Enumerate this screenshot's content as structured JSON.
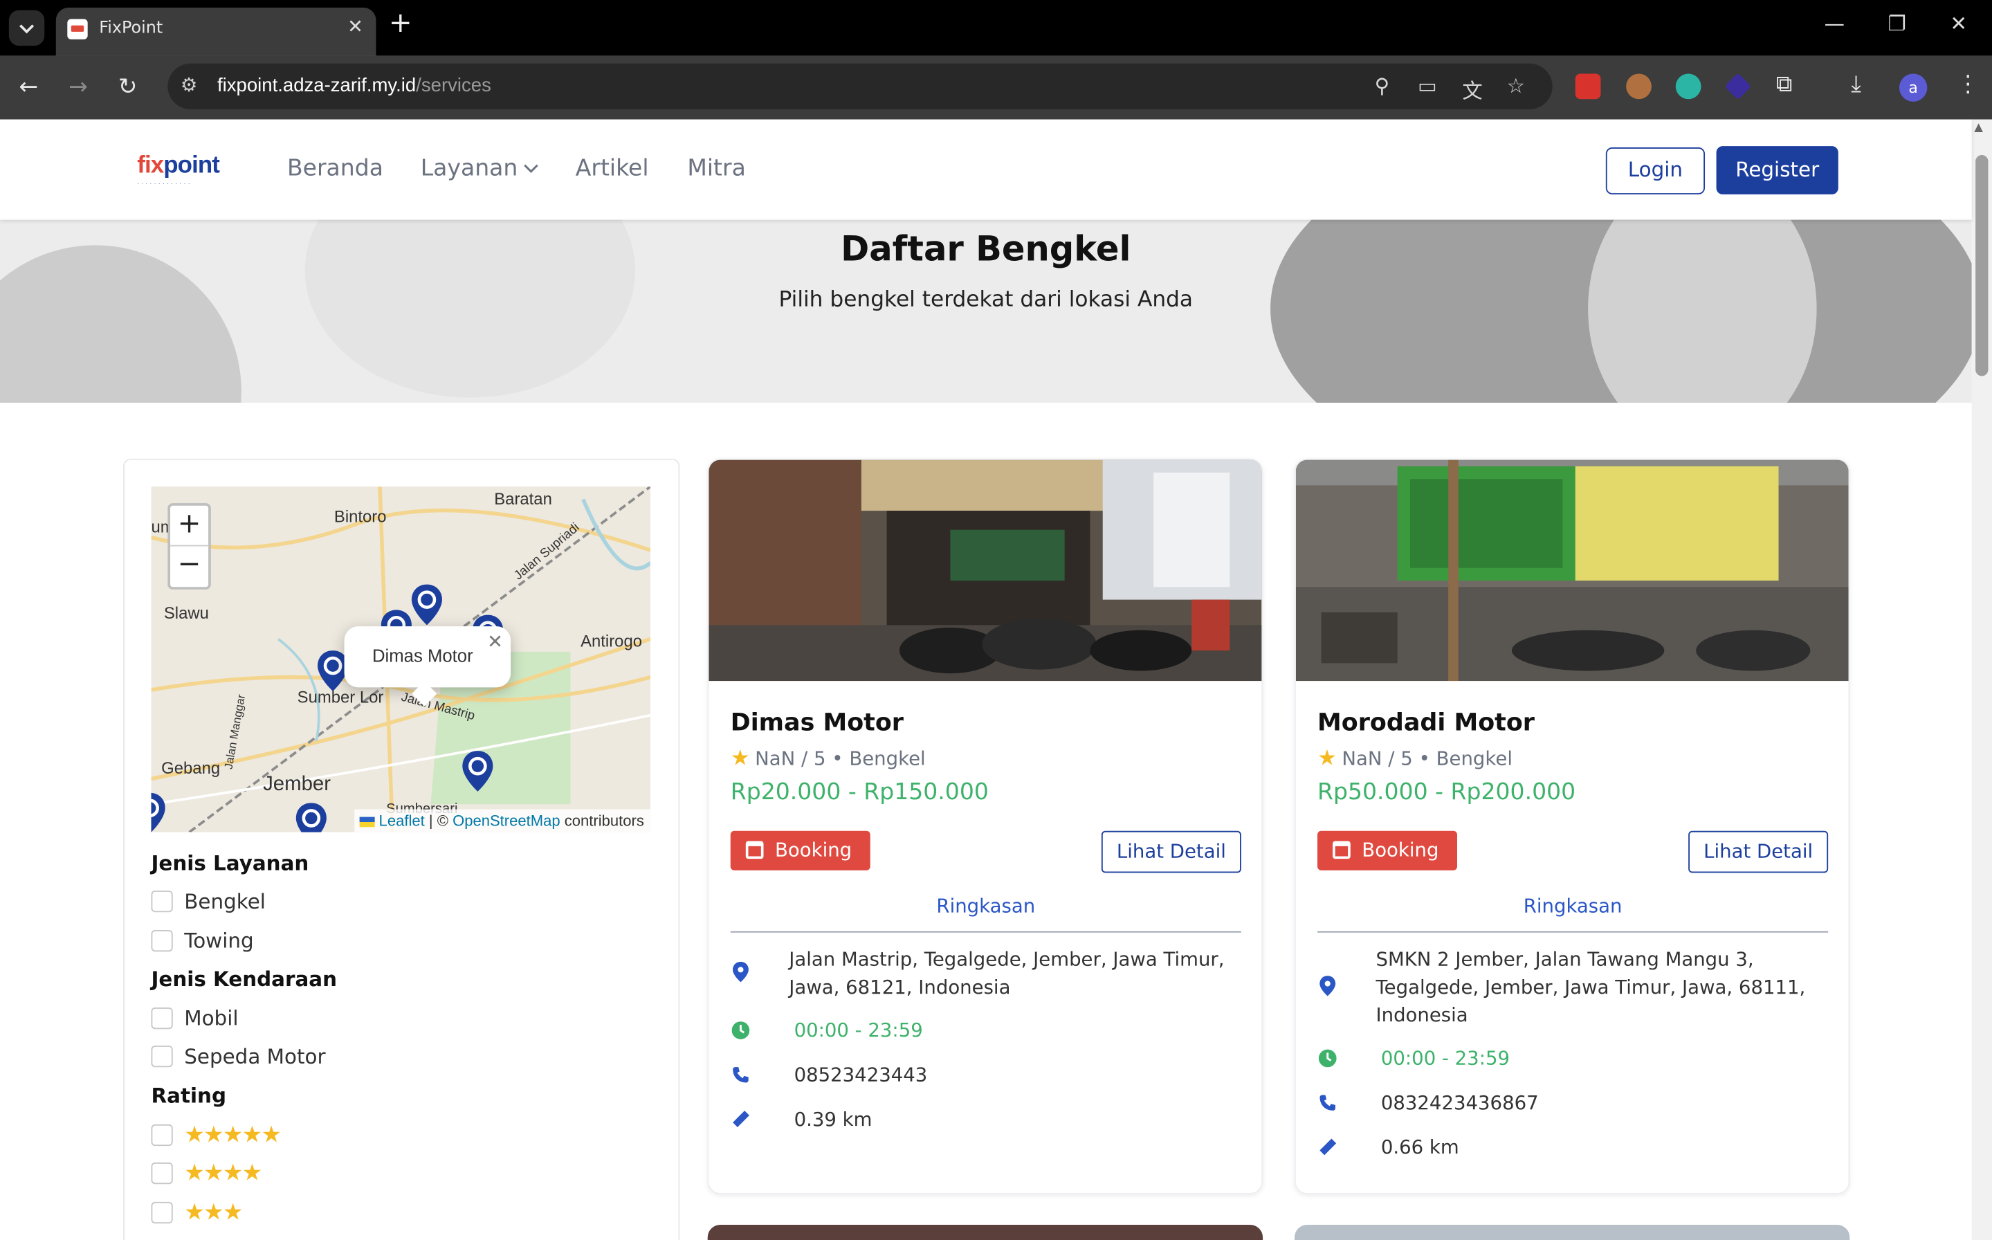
{
  "browser": {
    "tab_title": "FixPoint",
    "url_host": "fixpoint.adza-zarif.my.id",
    "url_path": "/services",
    "profile_initial": "a"
  },
  "site": {
    "logo_text": "fixpoint",
    "nav": [
      {
        "label": "Beranda"
      },
      {
        "label": "Layanan"
      },
      {
        "label": "Artikel"
      },
      {
        "label": "Mitra"
      }
    ],
    "login_label": "Login",
    "register_label": "Register",
    "brand_color": "#1c3f9e"
  },
  "hero": {
    "title": "Daftar Bengkel",
    "subtitle": "Pilih bengkel terdekat dari lokasi Anda"
  },
  "map": {
    "zoom_in": "+",
    "zoom_out": "−",
    "popup_text": "Dimas Motor",
    "places": [
      "Bintoro",
      "Baratan",
      "Slawu",
      "Antirogo",
      "Sumber Lor",
      "Gebang",
      "Jember",
      "Jalan Mastrip",
      "Jalan Manggar",
      "Jalan Supriadi",
      "Sumbersari",
      "um"
    ],
    "attribution": {
      "leaflet": "Leaflet",
      "separator": "| ©",
      "osm": "OpenStreetMap",
      "suffix": "contributors"
    }
  },
  "filters": {
    "service_heading": "Jenis Layanan",
    "service_options": [
      {
        "label": "Bengkel",
        "checked": false
      },
      {
        "label": "Towing",
        "checked": false
      }
    ],
    "vehicle_heading": "Jenis Kendaraan",
    "vehicle_options": [
      {
        "label": "Mobil",
        "checked": false
      },
      {
        "label": "Sepeda Motor",
        "checked": false
      }
    ],
    "rating_heading": "Rating",
    "rating_options": [
      {
        "stars": 5,
        "display": "★★★★★"
      },
      {
        "stars": 4,
        "display": "★★★★"
      },
      {
        "stars": 3,
        "display": "★★★"
      }
    ]
  },
  "services": [
    {
      "name": "Dimas Motor",
      "rating": "NaN / 5",
      "separator": "•",
      "type": "Bengkel",
      "price": "Rp20.000 - Rp150.000",
      "booking_label": "Booking",
      "detail_label": "Lihat Detail",
      "summary_label": "Ringkasan",
      "address": "Jalan Mastrip, Tegalgede, Jember, Jawa Timur, Jawa, 68121, Indonesia",
      "hours": "00:00 - 23:59",
      "phone": "08523423443",
      "distance": "0.39 km"
    },
    {
      "name": "Morodadi Motor",
      "rating": "NaN / 5",
      "separator": "•",
      "type": "Bengkel",
      "price": "Rp50.000 - Rp200.000",
      "booking_label": "Booking",
      "detail_label": "Lihat Detail",
      "summary_label": "Ringkasan",
      "address": "SMKN 2 Jember, Jalan Tawang Mangu 3, Tegalgede, Jember, Jawa Timur, Jawa, 68111, Indonesia",
      "hours": "00:00 - 23:59",
      "phone": "0832423436867",
      "distance": "0.66 km"
    }
  ],
  "colors": {
    "price_green": "#3eb26b",
    "booking_red": "#e0493f",
    "star_yellow": "#f5b921",
    "link_blue": "#2a56c6"
  }
}
